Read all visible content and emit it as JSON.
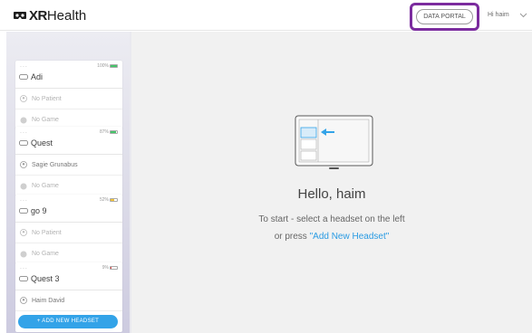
{
  "header": {
    "logo_bold": "XR",
    "logo_light": "Health",
    "data_portal_label": "DATA PORTAL",
    "greeting": "Hi haim"
  },
  "sidebar": {
    "headsets": [
      {
        "name": "Adi",
        "battery": "100%",
        "battery_level": 1.0,
        "battery_color": "#46c46a",
        "patient": "No Patient",
        "patient_filled": false,
        "game": "No Game"
      },
      {
        "name": "Quest",
        "battery": "87%",
        "battery_level": 0.87,
        "battery_color": "#46c46a",
        "patient": "Sagie Grunabus",
        "patient_filled": true,
        "game": "No Game"
      },
      {
        "name": "go 9",
        "battery": "52%",
        "battery_level": 0.52,
        "battery_color": "#f0c23a",
        "patient": "No Patient",
        "patient_filled": false,
        "game": "No Game"
      },
      {
        "name": "Quest 3",
        "battery": "9%",
        "battery_level": 0.09,
        "battery_color": "#e04b4b",
        "patient": "Haim David",
        "patient_filled": true,
        "game": ""
      }
    ],
    "add_button_label": "+ ADD NEW HEADSET"
  },
  "main": {
    "title": "Hello, haim",
    "instruction_line1": "To start - select a headset on the left",
    "instruction_prefix": "or press ",
    "instruction_link": "\"Add New Headset\""
  },
  "colors": {
    "accent": "#33a3e8",
    "highlight": "#7b2c9e"
  }
}
